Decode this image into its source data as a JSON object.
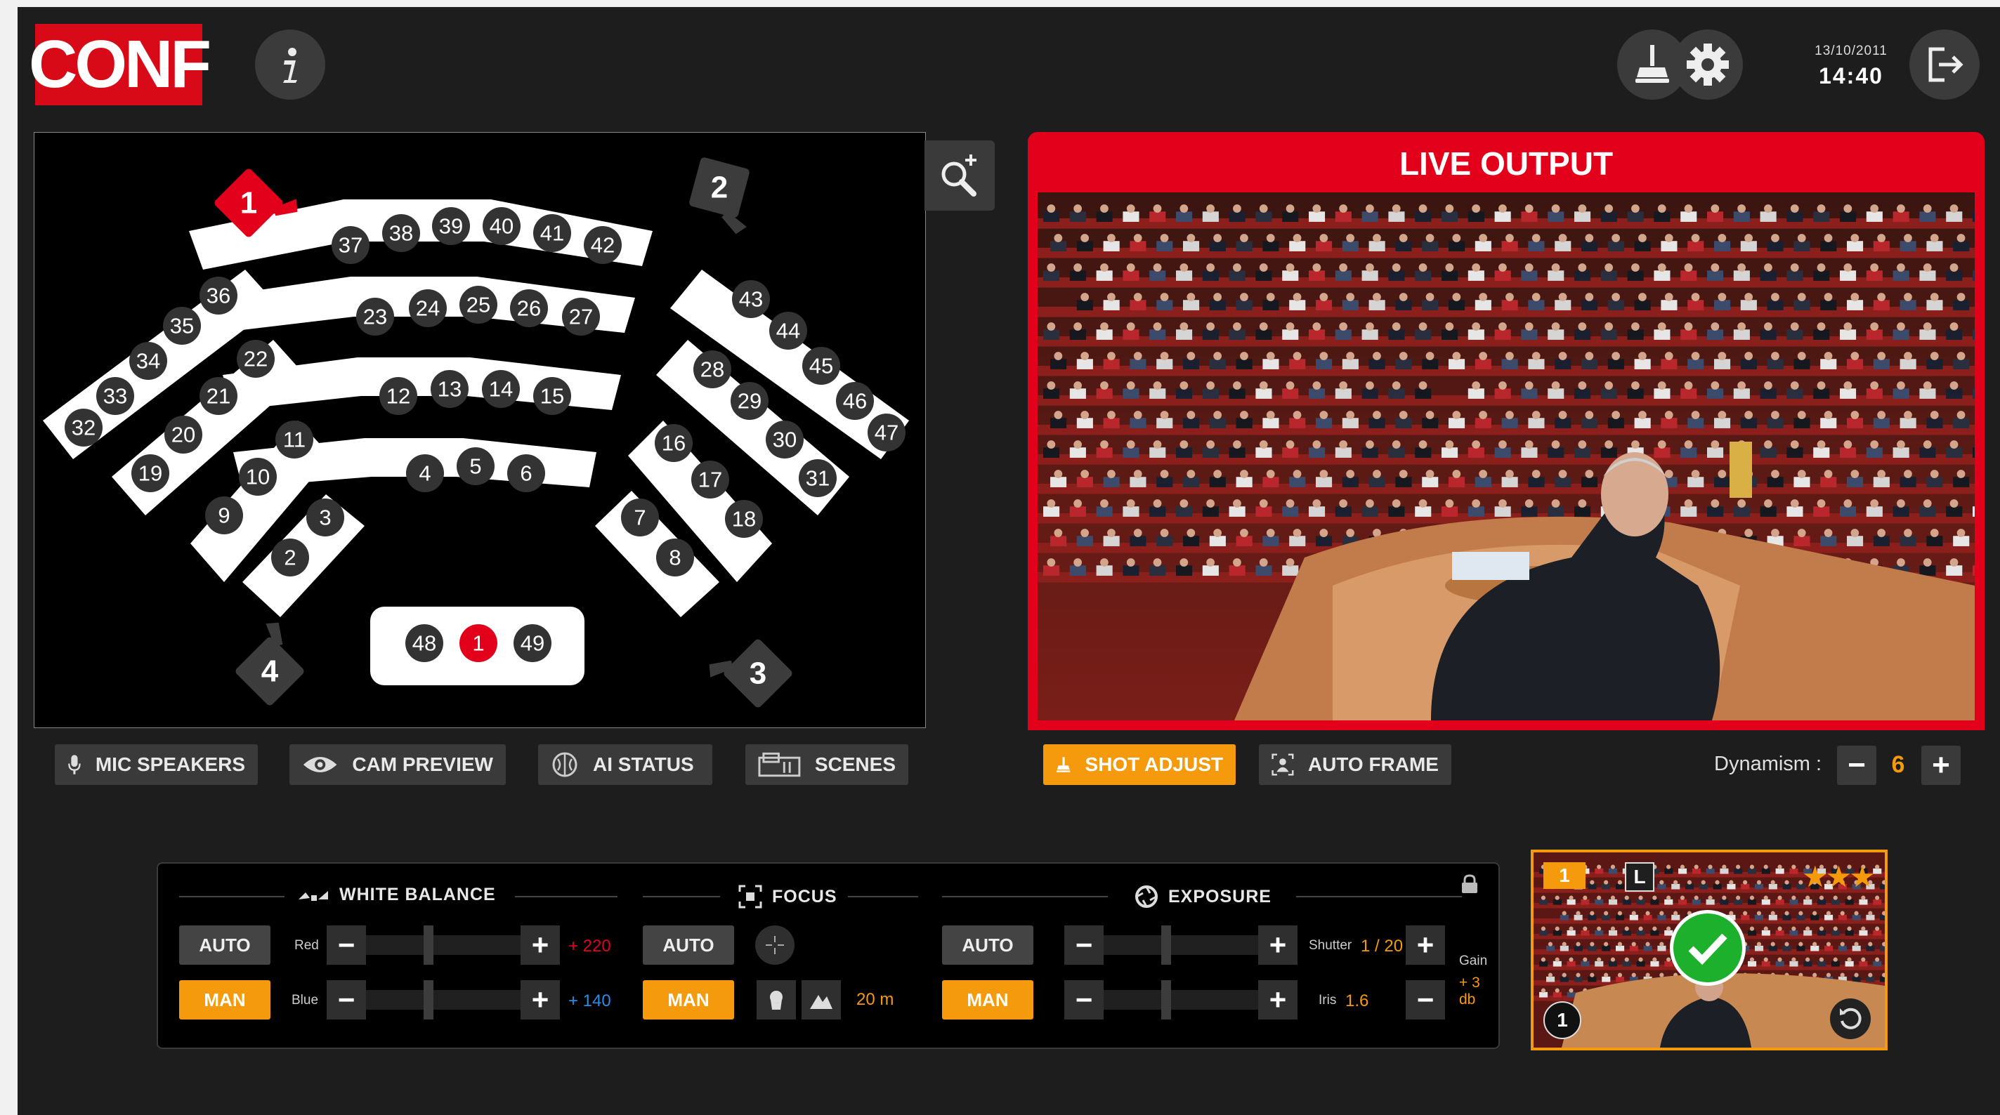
{
  "header": {
    "logo_text": "CONF",
    "info_icon": "info-icon",
    "date": "13/10/2011",
    "time": "14:40"
  },
  "seat_map": {
    "cameras": [
      "1",
      "2",
      "3",
      "4"
    ],
    "rows": {
      "left_outer": [
        "32",
        "33",
        "34",
        "35",
        "36"
      ],
      "left_mid": [
        "19",
        "20",
        "21",
        "22"
      ],
      "left_inner": [
        "9",
        "10",
        "11"
      ],
      "left_front": [
        "2",
        "3"
      ],
      "center_r5": [
        "37",
        "38",
        "39",
        "40",
        "41",
        "42"
      ],
      "center_r4": [
        "23",
        "24",
        "25",
        "26",
        "27"
      ],
      "center_r3": [
        "12",
        "13",
        "14",
        "15"
      ],
      "center_r2": [
        "4",
        "5",
        "6"
      ],
      "right_outer": [
        "43",
        "44",
        "45",
        "46",
        "47"
      ],
      "right_mid": [
        "28",
        "29",
        "30",
        "31"
      ],
      "right_inner": [
        "16",
        "17",
        "18"
      ],
      "right_front": [
        "7",
        "8"
      ],
      "podium": [
        "48",
        "1",
        "49"
      ]
    },
    "active_seat": "1"
  },
  "live_output": {
    "title": "LIVE OUTPUT"
  },
  "toolbar": {
    "mic_speakers": "MIC SPEAKERS",
    "cam_preview": "CAM PREVIEW",
    "ai_status": "AI STATUS",
    "scenes": "SCENES",
    "shot_adjust": "SHOT ADJUST",
    "auto_frame": "AUTO FRAME",
    "dynamism_label": "Dynamism :",
    "dynamism_value": "6",
    "minus": "−",
    "plus": "+"
  },
  "panel": {
    "white_balance": {
      "title": "WHITE BALANCE",
      "auto": "AUTO",
      "man": "MAN",
      "red_label": "Red",
      "red_value": "+ 220",
      "blue_label": "Blue",
      "blue_value": "+ 140"
    },
    "focus": {
      "title": "FOCUS",
      "auto": "AUTO",
      "man": "MAN",
      "distance": "20 m"
    },
    "exposure": {
      "title": "EXPOSURE",
      "auto": "AUTO",
      "man": "MAN",
      "shutter_label": "Shutter",
      "shutter_value": "1 / 20",
      "iris_label": "Iris",
      "iris_value": "1.6",
      "gain_label": "Gain",
      "gain_value": "+ 3 db"
    }
  },
  "thumbnail": {
    "cam_badge": "1",
    "lens_badge": "L",
    "seat_badge": "1",
    "stars": 3
  },
  "colors": {
    "accent_red": "#e3001b",
    "accent_orange": "#f59a0c",
    "background": "#1d1d1d"
  }
}
